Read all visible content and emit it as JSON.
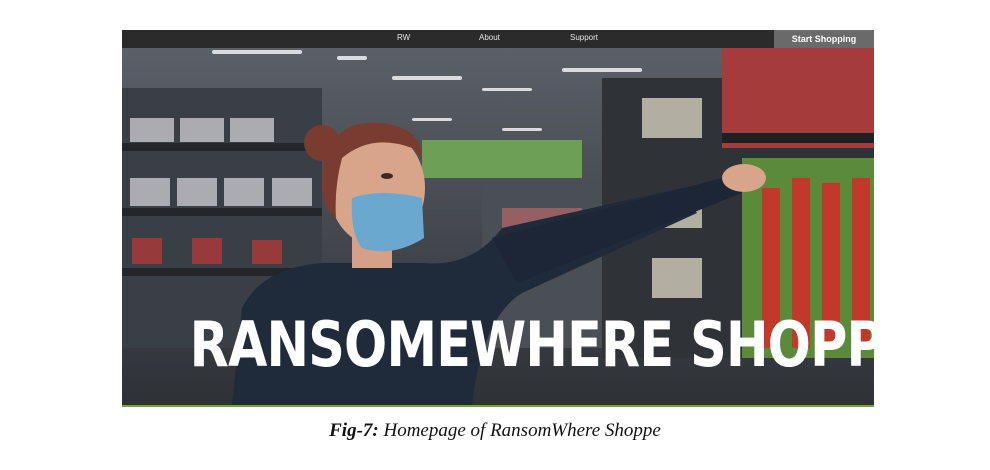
{
  "nav": {
    "items": [
      "RW",
      "About",
      "Support"
    ],
    "cta_label": "Start Shopping"
  },
  "hero": {
    "title": "RANSOMEWHERE SHOPPEE"
  },
  "caption": {
    "label": "Fig-7:",
    "text": "Homepage of RansomWhere Shoppe"
  },
  "colors": {
    "navbar": "#2b2b2b",
    "cta": "#6a6a6a",
    "border": "#7aa334",
    "mask": "#6aa8cf"
  }
}
